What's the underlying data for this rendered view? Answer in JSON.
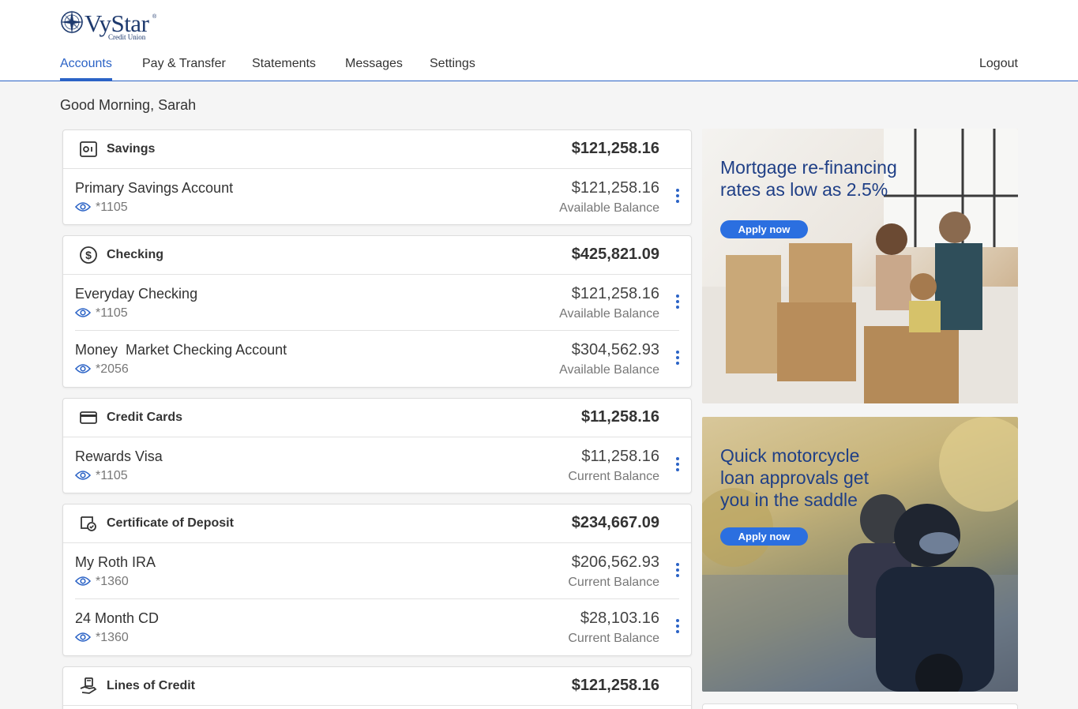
{
  "brand": {
    "name": "VyStar",
    "sub": "Credit Union",
    "reg": "®"
  },
  "nav": {
    "accounts": "Accounts",
    "pay": "Pay & Transfer",
    "statements": "Statements",
    "messages": "Messages",
    "settings": "Settings",
    "logout": "Logout"
  },
  "greeting": "Good Morning, Sarah",
  "savings": {
    "title": "Savings",
    "total": "$121,258.16",
    "rows": [
      {
        "name": "Primary Savings Account",
        "num": "*1105",
        "amount": "$121,258.16",
        "label": "Available Balance"
      }
    ]
  },
  "checking": {
    "title": "Checking",
    "total": "$425,821.09",
    "rows": [
      {
        "name": "Everyday Checking",
        "num": "*1105",
        "amount": "$121,258.16",
        "label": "Available Balance"
      },
      {
        "name": "Money  Market Checking Account",
        "num": "*2056",
        "amount": "$304,562.93",
        "label": "Available Balance"
      }
    ]
  },
  "credit": {
    "title": "Credit Cards",
    "total": "$11,258.16",
    "rows": [
      {
        "name": "Rewards Visa",
        "num": "*1105",
        "amount": "$11,258.16",
        "label": "Current Balance"
      }
    ]
  },
  "cd": {
    "title": "Certificate of Deposit",
    "total": "$234,667.09",
    "rows": [
      {
        "name": "My Roth IRA",
        "num": "*1360",
        "amount": "$206,562.93",
        "label": "Current Balance"
      },
      {
        "name": "24 Month CD",
        "num": "*1360",
        "amount": "$28,103.16",
        "label": "Current Balance"
      }
    ]
  },
  "loc": {
    "title": "Lines of Credit",
    "total": "$121,258.16"
  },
  "promo1": {
    "title": "Mortgage re-financing rates as low as 2.5%",
    "button": "Apply now"
  },
  "promo2": {
    "title": "Quick motorcycle loan approvals get you in the saddle",
    "button": "Apply now"
  },
  "colors": {
    "accent": "#2b63c6",
    "promo_text": "#1f3f86",
    "button": "#2b6fe0"
  },
  "icons": {
    "savings": "safe-icon",
    "checking": "dollar-circle-icon",
    "credit": "credit-card-icon",
    "cd": "certificate-icon",
    "loc": "hand-money-icon",
    "row_view": "eye-icon",
    "row_menu": "more-vertical-icon"
  }
}
